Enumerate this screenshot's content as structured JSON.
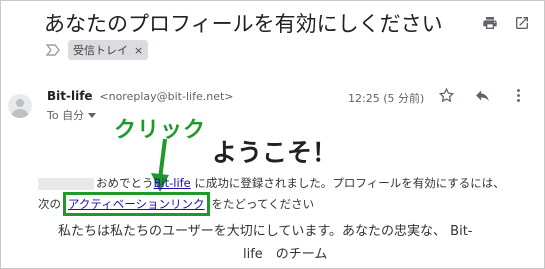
{
  "email": {
    "subject": "あなたのプロフィールを有効にしください",
    "label": "受信トレイ",
    "label_remove": "×",
    "sender_name": "Bit-life",
    "sender_address": "<noreplay@bit-life.net>",
    "to_line": "To 自分",
    "time": "12:25 (5 分前)"
  },
  "annotation": {
    "text": "クリック",
    "color": "#1e9a2a"
  },
  "message": {
    "heading": "ようこそ！",
    "line1_prefix": "おめでとう",
    "line1_link": "Bit-life",
    "line1_suffix": " に成功に登録されました。プロフィールを有効にするには、",
    "line2_prefix": "次の",
    "line2_link": "アクティベーションリンク",
    "line2_suffix": "をたどってください",
    "line3": "私たちは私たちのユーザーを大切にしています。あなたの忠実な、 Bit-",
    "line4": "life　のチーム"
  },
  "icons": {
    "print": "print-icon",
    "open_new_window": "open-in-new-window-icon",
    "star": "star-icon",
    "reply": "reply-icon",
    "more": "more-vertical-icon",
    "important": "importance-marker-icon",
    "dropdown": "chevron-down-icon",
    "avatar": "avatar-icon"
  }
}
